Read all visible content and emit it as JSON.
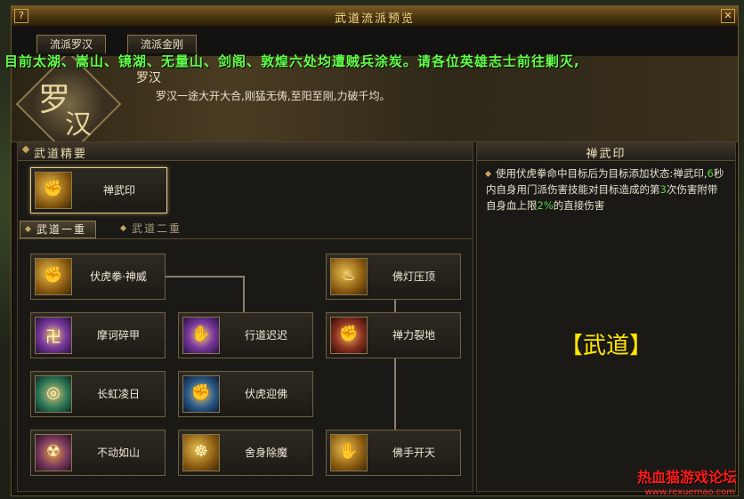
{
  "window": {
    "title": "武道流派预览",
    "help_label": "?",
    "close_label": "✕"
  },
  "tabs": [
    {
      "label": "流派罗汉"
    },
    {
      "label": "流派金刚"
    }
  ],
  "ticker": "目前太湖、嵩山、镜湖、无量山、剑阁、敦煌六处均遭贼兵涂炭。请各位英雄志士前往剿灭,",
  "banner": {
    "emblem_char1": "罗",
    "emblem_char2": "汉",
    "school_name": "罗汉",
    "description": "罗汉一途大开大合,刚猛无俦,至阳至刚,力破千均。"
  },
  "left": {
    "section_title": "武道精要",
    "featured": {
      "label": "禅武印",
      "icon": "fist-gold-icon"
    },
    "subtabs": [
      {
        "label": "武道一重"
      },
      {
        "label": "武道二重"
      }
    ],
    "skills": [
      {
        "label": "伏虎拳·神威",
        "icon": "fist-gold-icon"
      },
      {
        "label": "佛灯压顶",
        "icon": "lamp-gold-icon"
      },
      {
        "label": "摩诃碎甲",
        "icon": "swastika-purple-icon"
      },
      {
        "label": "行道迟迟",
        "icon": "palm-purple-icon"
      },
      {
        "label": "禅力裂地",
        "icon": "arm-red-icon"
      },
      {
        "label": "长虹凌日",
        "icon": "swirl-green-icon"
      },
      {
        "label": "伏虎迎佛",
        "icon": "fist-blue-icon"
      },
      {
        "label": "不动如山",
        "icon": "tiger-icon"
      },
      {
        "label": "舍身除魔",
        "icon": "monk-gold-icon"
      },
      {
        "label": "佛手开天",
        "icon": "hand-gold-icon"
      }
    ]
  },
  "right": {
    "title": "禅武印",
    "desc_parts": [
      "使用伏虎拳命中目标后为目标添加状态:禅武印,",
      "6",
      "秒内自身用门派伤害技能对目标造成的第",
      "3",
      "次伤害附带自身血上限",
      "2%",
      "的直接伤害"
    ],
    "big_label": "【武道】"
  },
  "watermark": {
    "main": "热血猫游戏论坛",
    "url": "www.rexuemao.com"
  }
}
